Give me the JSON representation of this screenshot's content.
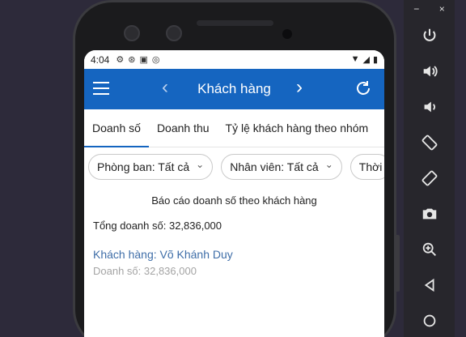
{
  "status": {
    "time": "4:04"
  },
  "appbar": {
    "title": "Khách hàng",
    "prev": "‹",
    "next": "›"
  },
  "tabs": [
    {
      "label": "Doanh số"
    },
    {
      "label": "Doanh thu"
    },
    {
      "label": "Tỷ lệ khách hàng theo nhóm"
    }
  ],
  "filters": [
    {
      "label": "Phòng ban: Tất cả"
    },
    {
      "label": "Nhân viên: Tất cả"
    },
    {
      "label": "Thời"
    }
  ],
  "report": {
    "title": "Báo cáo doanh số theo khách hàng",
    "total": "Tổng doanh số: 32,836,000"
  },
  "customers": [
    {
      "name": "Khách hàng: Võ Khánh Duy",
      "sales": "Doanh số: 32,836,000"
    }
  ],
  "emulator": {
    "minimize": "−",
    "close": "×"
  }
}
